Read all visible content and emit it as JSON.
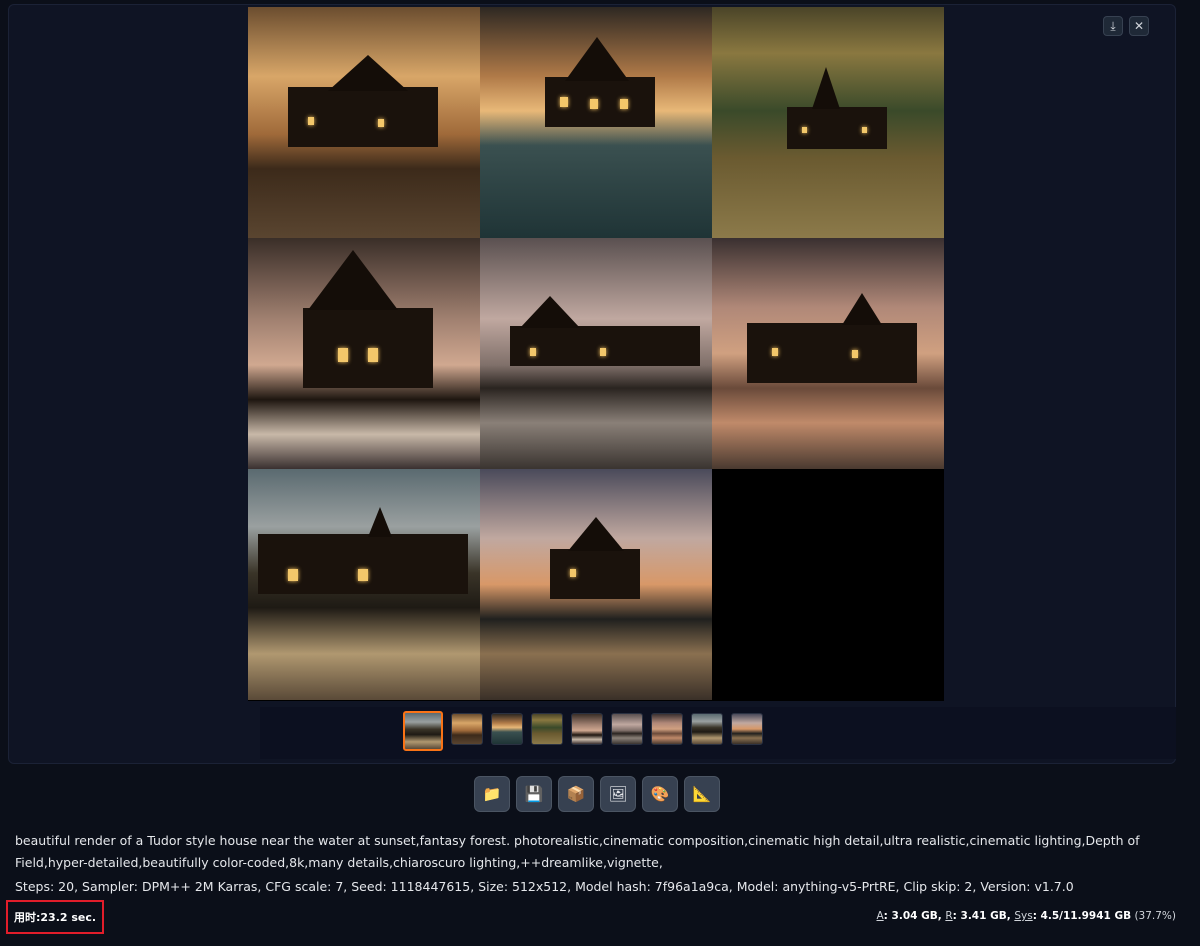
{
  "gallery": {
    "download_icon": "download-icon",
    "close_icon": "close-icon",
    "images": [
      "tudor-house-1",
      "tudor-house-2",
      "tudor-house-3",
      "tudor-house-4",
      "tudor-house-5",
      "tudor-house-6",
      "tudor-house-7",
      "tudor-house-8",
      "empty"
    ],
    "thumbnail_count": 9,
    "selected_thumbnail": 0
  },
  "toolbar": {
    "buttons": [
      {
        "name": "open-folder",
        "icon": "📁"
      },
      {
        "name": "save",
        "icon": "💾"
      },
      {
        "name": "zip",
        "icon": "📦"
      },
      {
        "name": "send-to-img2img",
        "icon": "🖼"
      },
      {
        "name": "send-to-inpaint",
        "icon": "🎨"
      },
      {
        "name": "send-to-extras",
        "icon": "📐"
      }
    ]
  },
  "info": {
    "prompt": "beautiful render of a Tudor style house near the water at sunset,fantasy forest. photorealistic,cinematic composition,cinematic high detail,ultra realistic,cinematic lighting,Depth of Field,hyper-detailed,beautifully color-coded,8k,many details,chiaroscuro lighting,++dreamlike,vignette,",
    "params": "Steps: 20, Sampler: DPM++ 2M Karras, CFG scale: 7, Seed: 1118447615, Size: 512x512, Model hash: 7f96a1a9ca, Model: anything-v5-PrtRE, Clip skip: 2, Version: v1.7.0"
  },
  "footer": {
    "time_label": "用时:",
    "time_value": "23.2 sec.",
    "mem_a_label": "A",
    "mem_a": ": 3.04 GB, ",
    "mem_r_label": "R",
    "mem_r": ": 3.41 GB, ",
    "mem_sys_label": "Sys",
    "mem_sys": ": 4.5/11.9941 GB",
    "mem_pct": " (37.7%)"
  },
  "colors": {
    "accent": "#f97316",
    "highlight_box": "#e11d2a",
    "background": "#0b0f19"
  }
}
